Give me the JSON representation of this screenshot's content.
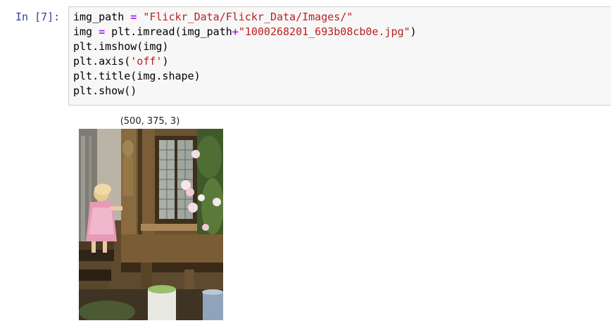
{
  "cell": {
    "prompt": "In [7]:",
    "code_lines": [
      [
        {
          "t": "id",
          "v": "img_path "
        },
        {
          "t": "op",
          "v": "="
        },
        {
          "t": "id",
          "v": " "
        },
        {
          "t": "str",
          "v": "\"Flickr_Data/Flickr_Data/Images/\""
        }
      ],
      [
        {
          "t": "id",
          "v": "img "
        },
        {
          "t": "op",
          "v": "="
        },
        {
          "t": "id",
          "v": " plt.imread(img_path"
        },
        {
          "t": "op",
          "v": "+"
        },
        {
          "t": "str",
          "v": "\"1000268201_693b08cb0e.jpg\""
        },
        {
          "t": "id",
          "v": ")"
        }
      ],
      [
        {
          "t": "id",
          "v": "plt.imshow(img)"
        }
      ],
      [
        {
          "t": "id",
          "v": "plt.axis("
        },
        {
          "t": "str",
          "v": "'off'"
        },
        {
          "t": "id",
          "v": ")"
        }
      ],
      [
        {
          "t": "id",
          "v": "plt.title(img.shape)"
        }
      ],
      [
        {
          "t": "id",
          "v": "plt.show()"
        }
      ]
    ]
  },
  "output": {
    "plot_title": "(500, 375, 3)",
    "image_subject": "photo-girl-pink-dress-climbing-stairs-of-wooden-playhouse"
  },
  "colors": {
    "prompt": "#303f9f",
    "string": "#ba2121",
    "operator": "#aa22ff",
    "input_bg": "#f7f7f7",
    "input_border": "#cfcfcf"
  }
}
